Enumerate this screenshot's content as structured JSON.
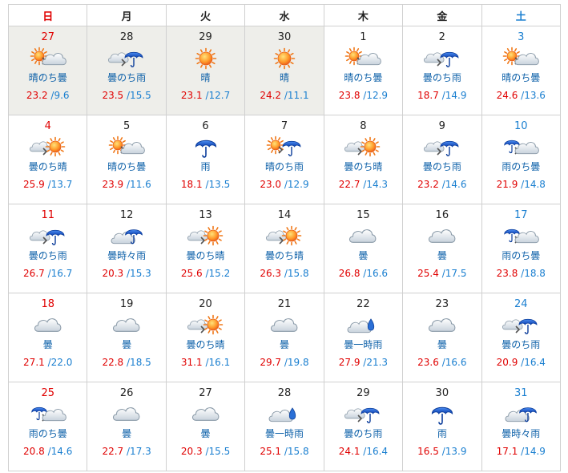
{
  "calendar": {
    "weekdays": [
      {
        "label": "日",
        "color": "#e00000"
      },
      {
        "label": "月",
        "color": "#222222"
      },
      {
        "label": "火",
        "color": "#222222"
      },
      {
        "label": "水",
        "color": "#222222"
      },
      {
        "label": "木",
        "color": "#222222"
      },
      {
        "label": "金",
        "color": "#222222"
      },
      {
        "label": "土",
        "color": "#1a7fd0"
      }
    ],
    "weeks": [
      [
        {
          "day": "27",
          "weather": "晴のち曇",
          "icon": "sun-then-cloud",
          "high": "23.2",
          "low": "/9.6",
          "past": true
        },
        {
          "day": "28",
          "weather": "曇のち雨",
          "icon": "cloud-then-rain",
          "high": "23.5",
          "low": "/15.5",
          "past": true
        },
        {
          "day": "29",
          "weather": "晴",
          "icon": "sun",
          "high": "23.1",
          "low": "/12.7",
          "past": true
        },
        {
          "day": "30",
          "weather": "晴",
          "icon": "sun",
          "high": "24.2",
          "low": "/11.1",
          "past": true
        },
        {
          "day": "1",
          "weather": "晴のち曇",
          "icon": "sun-then-cloud",
          "high": "23.8",
          "low": "/12.9",
          "past": false
        },
        {
          "day": "2",
          "weather": "曇のち雨",
          "icon": "cloud-then-rain",
          "high": "18.7",
          "low": "/14.9",
          "past": false
        },
        {
          "day": "3",
          "weather": "晴のち曇",
          "icon": "sun-then-cloud",
          "high": "24.6",
          "low": "/13.6",
          "past": false
        }
      ],
      [
        {
          "day": "4",
          "weather": "曇のち晴",
          "icon": "cloud-then-sun",
          "high": "25.9",
          "low": "/13.7",
          "past": false
        },
        {
          "day": "5",
          "weather": "晴のち曇",
          "icon": "sun-then-cloud",
          "high": "23.9",
          "low": "/11.6",
          "past": false
        },
        {
          "day": "6",
          "weather": "雨",
          "icon": "rain",
          "high": "18.1",
          "low": "/13.5",
          "past": false
        },
        {
          "day": "7",
          "weather": "晴のち雨",
          "icon": "sun-then-rain",
          "high": "23.0",
          "low": "/12.9",
          "past": false
        },
        {
          "day": "8",
          "weather": "曇のち晴",
          "icon": "cloud-then-sun",
          "high": "22.7",
          "low": "/14.3",
          "past": false
        },
        {
          "day": "9",
          "weather": "曇のち雨",
          "icon": "cloud-then-rain",
          "high": "23.2",
          "low": "/14.6",
          "past": false
        },
        {
          "day": "10",
          "weather": "雨のち曇",
          "icon": "rain-then-cloud",
          "high": "21.9",
          "low": "/14.8",
          "past": false
        }
      ],
      [
        {
          "day": "11",
          "weather": "曇のち雨",
          "icon": "cloud-then-rain",
          "high": "26.7",
          "low": "/16.7",
          "past": false
        },
        {
          "day": "12",
          "weather": "曇時々雨",
          "icon": "cloud-sometimes-rain",
          "high": "20.3",
          "low": "/15.3",
          "past": false
        },
        {
          "day": "13",
          "weather": "曇のち晴",
          "icon": "cloud-then-sun",
          "high": "25.6",
          "low": "/15.2",
          "past": false
        },
        {
          "day": "14",
          "weather": "曇のち晴",
          "icon": "cloud-then-sun",
          "high": "26.3",
          "low": "/15.8",
          "past": false
        },
        {
          "day": "15",
          "weather": "曇",
          "icon": "cloud",
          "high": "26.8",
          "low": "/16.6",
          "past": false
        },
        {
          "day": "16",
          "weather": "曇",
          "icon": "cloud",
          "high": "25.4",
          "low": "/17.5",
          "past": false
        },
        {
          "day": "17",
          "weather": "雨のち曇",
          "icon": "rain-then-cloud",
          "high": "23.8",
          "low": "/18.8",
          "past": false
        }
      ],
      [
        {
          "day": "18",
          "weather": "曇",
          "icon": "cloud",
          "high": "27.1",
          "low": "/22.0",
          "past": false
        },
        {
          "day": "19",
          "weather": "曇",
          "icon": "cloud",
          "high": "22.8",
          "low": "/18.5",
          "past": false
        },
        {
          "day": "20",
          "weather": "曇のち晴",
          "icon": "cloud-then-sun",
          "high": "31.1",
          "low": "/16.1",
          "past": false
        },
        {
          "day": "21",
          "weather": "曇",
          "icon": "cloud",
          "high": "29.7",
          "low": "/19.8",
          "past": false
        },
        {
          "day": "22",
          "weather": "曇一時雨",
          "icon": "cloud-temporary-rain",
          "high": "27.9",
          "low": "/21.3",
          "past": false
        },
        {
          "day": "23",
          "weather": "曇",
          "icon": "cloud",
          "high": "23.6",
          "low": "/16.6",
          "past": false
        },
        {
          "day": "24",
          "weather": "曇のち雨",
          "icon": "cloud-then-rain",
          "high": "20.9",
          "low": "/16.4",
          "past": false
        }
      ],
      [
        {
          "day": "25",
          "weather": "雨のち曇",
          "icon": "rain-then-cloud",
          "high": "20.8",
          "low": "/14.6",
          "past": false
        },
        {
          "day": "26",
          "weather": "曇",
          "icon": "cloud",
          "high": "22.7",
          "low": "/17.3",
          "past": false
        },
        {
          "day": "27",
          "weather": "曇",
          "icon": "cloud",
          "high": "20.3",
          "low": "/15.5",
          "past": false
        },
        {
          "day": "28",
          "weather": "曇一時雨",
          "icon": "cloud-temporary-rain",
          "high": "25.1",
          "low": "/15.8",
          "past": false
        },
        {
          "day": "29",
          "weather": "曇のち雨",
          "icon": "cloud-then-rain",
          "high": "24.1",
          "low": "/16.4",
          "past": false
        },
        {
          "day": "30",
          "weather": "雨",
          "icon": "rain",
          "high": "16.5",
          "low": "/13.9",
          "past": false
        },
        {
          "day": "31",
          "weather": "曇時々雨",
          "icon": "cloud-sometimes-rain",
          "high": "17.1",
          "low": "/14.9",
          "past": false
        }
      ]
    ]
  }
}
